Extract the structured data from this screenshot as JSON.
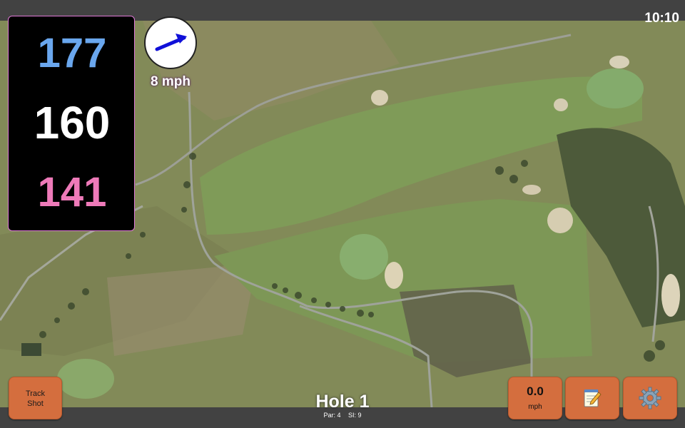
{
  "status": {
    "time": "10:10"
  },
  "distances": {
    "back": "177",
    "center": "160",
    "front": "141"
  },
  "wind": {
    "speed": "8 mph",
    "icon": "arrow-up-right-icon"
  },
  "buttons": {
    "track_shot": [
      "Track",
      "Shot"
    ],
    "speed_value": "0.0",
    "speed_unit": "mph",
    "notes_icon": "notepad-icon",
    "settings_icon": "gear-icon"
  },
  "hole": {
    "title": "Hole 1",
    "par": "Par: 4",
    "si": "SI: 9"
  },
  "colors": {
    "back": "#6aa7ee",
    "center": "#ffffff",
    "front": "#ee7ab9",
    "button": "#d46e3e",
    "panel_border": "#e07ad8"
  }
}
